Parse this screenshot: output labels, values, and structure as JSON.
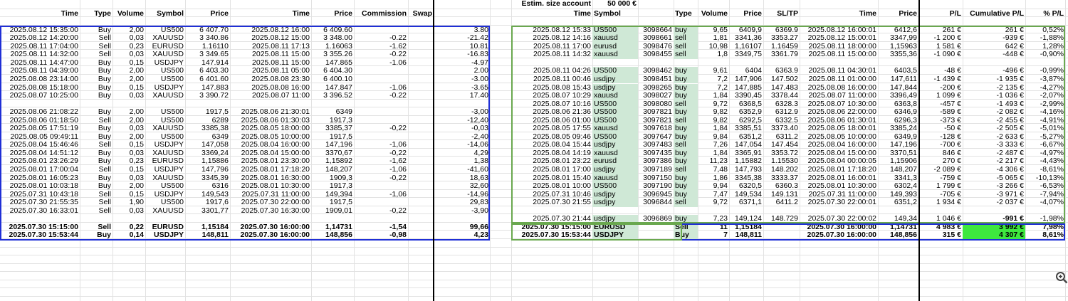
{
  "top": {
    "label": "Estim. size account",
    "value": "50 000 €"
  },
  "left_headers": [
    "Time",
    "Type",
    "Volume",
    "Symbol",
    "Price",
    "Time",
    "Price",
    "Commission",
    "Swap",
    ""
  ],
  "right_headers": [
    "Time",
    "Symbol",
    "",
    "Type",
    "Volume",
    "Price",
    "SL/TP",
    "Time",
    "Price",
    "P/L",
    "Cumulative P/L",
    "% P/L"
  ],
  "left_rows": [
    [
      "2025.08.12 15:35:00",
      "Buy",
      "2,00",
      "US500",
      "6 407.70",
      "2025.08.12 16:00",
      "6 409.60",
      "",
      "",
      "3.80"
    ],
    [
      "2025.08.12 14:20:00",
      "Sell",
      "0,03",
      "XAUUSD",
      "3 340.86",
      "2025.08.12 15:00",
      "3 348.00",
      "-0.22",
      "",
      "-21.42"
    ],
    [
      "2025.08.11 17:04:00",
      "Sell",
      "0,23",
      "EURUSD",
      "1.16110",
      "2025.08.11 17:13",
      "1.16063",
      "-1.62",
      "",
      "10.81"
    ],
    [
      "2025.08.11 14:32:00",
      "Sell",
      "0,03",
      "XAUUSD",
      "3 349.65",
      "2025.08.11 15:00",
      "3 355.26",
      "-0.22",
      "",
      "-16.83"
    ],
    [
      "2025.08.11 14:47:00",
      "Buy",
      "0,15",
      "USDJPY",
      "147.914",
      "2025.08.11 15:00",
      "147.865",
      "-1.06",
      "",
      "-4.97"
    ],
    [
      "2025.08.11 04:39:00",
      "Buy",
      "2,00",
      "US500",
      "6 403.30",
      "2025.08.11 05:00",
      "6 404.30",
      "",
      "",
      "2.00"
    ],
    [
      "2025.08.08 23:14:00",
      "Buy",
      "2,00",
      "US500",
      "6 401.60",
      "2025.08.08 23:30",
      "6 400.10",
      "",
      "",
      "-3.00"
    ],
    [
      "2025.08.08 15:18:00",
      "Buy",
      "0,15",
      "USDJPY",
      "147.883",
      "2025.08.08 16:00",
      "147.847",
      "-1.06",
      "",
      "-3.65"
    ],
    [
      "2025.08.07 10:25:00",
      "Buy",
      "0,03",
      "XAUUSD",
      "3 390.72",
      "2025.08.07 11:00",
      "3 396.52",
      "-0.22",
      "",
      "17.40"
    ],
    [
      "",
      "",
      "",
      "",
      "",
      "",
      "",
      "",
      "",
      ""
    ],
    [
      "2025.08.06 21:08:22",
      "Buy",
      "2,00",
      "US500",
      "1917,5",
      "2025.08.06 21:30:01",
      "6349",
      "",
      "",
      "-3,00"
    ],
    [
      "2025.08.06 01:18:50",
      "Sell",
      "2,00",
      "US500",
      "6289",
      "2025.08.06 01:30:03",
      "1917,3",
      "",
      "",
      "-12,40"
    ],
    [
      "2025.08.05 17:51:19",
      "Buy",
      "0,03",
      "XAUUSD",
      "3385,38",
      "2025.08.05 18:00:00",
      "3385,37",
      "-0,22",
      "",
      "-0,03"
    ],
    [
      "2025.08.05 09:49:11",
      "Buy",
      "2,00",
      "US500",
      "6349",
      "2025.08.05 10:00:00",
      "1917,5",
      "",
      "",
      "-2,40"
    ],
    [
      "2025.08.04 15:46:46",
      "Sell",
      "0,15",
      "USDJPY",
      "147,058",
      "2025.08.04 16:00:00",
      "147,196",
      "-1,06",
      "",
      "-14,06"
    ],
    [
      "2025.08.04 14:51:12",
      "Buy",
      "0,03",
      "XAUUSD",
      "3369,24",
      "2025.08.04 15:00:00",
      "3370,67",
      "-0,22",
      "",
      "4,29"
    ],
    [
      "2025.08.01 23:26:29",
      "Buy",
      "0,23",
      "EURUSD",
      "1,15886",
      "2025.08.01 23:30:00",
      "1,15892",
      "-1,62",
      "",
      "1,38"
    ],
    [
      "2025.08.01 17:00:04",
      "Sell",
      "0,15",
      "USDJPY",
      "147,796",
      "2025.08.01 17:18:20",
      "148,207",
      "-1,06",
      "",
      "-41,60"
    ],
    [
      "2025.08.01 16:05:23",
      "Buy",
      "0,03",
      "XAUUSD",
      "3345,39",
      "2025.08.01 16:30:00",
      "1909,3",
      "-0,22",
      "",
      "18,63"
    ],
    [
      "2025.08.01 10:03:18",
      "Buy",
      "2,00",
      "US500",
      "6316",
      "2025.08.01 10:30:00",
      "1917,3",
      "",
      "",
      "32,60"
    ],
    [
      "2025.07.31 10:43:18",
      "Sell",
      "0,15",
      "USDJPY",
      "149,543",
      "2025.07.31 11:00:00",
      "149,394",
      "-1,06",
      "",
      "-14,96"
    ],
    [
      "2025.07.30 21:55:35",
      "Sell",
      "1,90",
      "US500",
      "1917,6",
      "2025.07.30 22:00:00",
      "1917,5",
      "",
      "",
      "29,83"
    ],
    [
      "2025.07.30 16:33:01",
      "Sell",
      "0,03",
      "XAUUSD",
      "3301,77",
      "2025.07.30 16:30:00",
      "1909,01",
      "-0,22",
      "",
      "-3,90"
    ],
    [
      "",
      "",
      "",
      "",
      "",
      "",
      "",
      "",
      "",
      ""
    ],
    [
      "2025.07.30 15:15:00",
      "Sell",
      "0,22",
      "EURUSD",
      "1,15184",
      "2025.07.30 16:00:00",
      "1,14731",
      "-1,54",
      "",
      "99,66"
    ],
    [
      "2025.07.30 15:53:44",
      "Buy",
      "0,14",
      "USDJPY",
      "148,811",
      "2025.07.30 16:00:00",
      "148,856",
      "-0,98",
      "",
      "4,23"
    ]
  ],
  "right_rows": [
    [
      "2025.08.12 15:33",
      "US500",
      "3098664",
      "buy",
      "9,65",
      "6409,9",
      "6369.9",
      "2025.08.12 16:00:01",
      "6412,6",
      "261 €",
      "261 €",
      "0,52%"
    ],
    [
      "2025.08.12 14:16",
      "xauusd",
      "3098661",
      "sell",
      "1,81",
      "3341,36",
      "3353.27",
      "2025.08.12 15:00:01",
      "3347,99",
      "-1 200 €",
      "-939 €",
      "-1,88%"
    ],
    [
      "2025.08.11 17:00",
      "eurusd",
      "3098476",
      "sell",
      "10,98",
      "1,16107",
      "1.16459",
      "2025.08.11 18:00:00",
      "1,15963",
      "1 581 €",
      "642 €",
      "1,28%"
    ],
    [
      "2025.08.11 14:32",
      "xauusd",
      "3098455",
      "sell",
      "1,8",
      "3349,75",
      "3361.79",
      "2025.08.11 15:00:00",
      "3355,36",
      "-1 090 €",
      "-448 €",
      "-0,90%"
    ],
    [
      "",
      "",
      "",
      "",
      "",
      "",
      "",
      "",
      "",
      "",
      "",
      ""
    ],
    [
      "2025.08.11 04:26",
      "US500",
      "3098462",
      "buy",
      "9,61",
      "6404",
      "6363.9",
      "2025.08.11 04:30:01",
      "6403,5",
      "-48 €",
      "-496 €",
      "-0,99%"
    ],
    [
      "2025.08.11 00:46",
      "usdjpy",
      "3098451",
      "buy",
      "7,2",
      "147,906",
      "147.502",
      "2025.08.11 01:00:00",
      "147,611",
      "-1 439 €",
      "-1 935 €",
      "-3,87%"
    ],
    [
      "2025.08.08 15:43",
      "usdjpy",
      "3098265",
      "buy",
      "7,2",
      "147,885",
      "147.483",
      "2025.08.08 16:00:00",
      "147,844",
      "-200 €",
      "-2 135 €",
      "-4,27%"
    ],
    [
      "2025.08.07 10:29",
      "xauusd",
      "3098027",
      "buy",
      "1,84",
      "3390,45",
      "3378.44",
      "2025.08.07 11:00:00",
      "3396,49",
      "1 099 €",
      "-1 036 €",
      "-2,07%"
    ],
    [
      "2025.08.07 10:16",
      "US500",
      "3098080",
      "sell",
      "9,72",
      "6368,5",
      "6328.3",
      "2025.08.07 10:30:00",
      "6363,8",
      "-457 €",
      "-1 493 €",
      "-2,99%"
    ],
    [
      "2025.08.06 21:36",
      "US500",
      "3097821",
      "buy",
      "9,82",
      "6352,9",
      "6312.9",
      "2025.08.06 22:00:00",
      "6346,9",
      "-589 €",
      "-2 082 €",
      "-4,16%"
    ],
    [
      "2025.08.06 01:00",
      "US500",
      "3097821",
      "sell",
      "9,82",
      "6292,5",
      "6332.5",
      "2025.08.06 01:30:01",
      "6296,3",
      "-373 €",
      "-2 455 €",
      "-4,91%"
    ],
    [
      "2025.08.05 17:55",
      "xauusd",
      "3097618",
      "buy",
      "1,84",
      "3385,51",
      "3373.40",
      "2025.08.05 18:00:01",
      "3385,24",
      "-50 €",
      "-2 505 €",
      "-5,01%"
    ],
    [
      "2025.08.05 09:46",
      "US500",
      "3097647",
      "buy",
      "9,84",
      "6351,2",
      "6311.2",
      "2025.08.05 10:00:00",
      "6349,9",
      "-128 €",
      "-2 633 €",
      "-5,27%"
    ],
    [
      "2025.08.04 15:44",
      "usdjpy",
      "3097483",
      "sell",
      "7,26",
      "147,054",
      "147.454",
      "2025.08.04 16:00:00",
      "147,196",
      "-700 €",
      "-3 333 €",
      "-6,67%"
    ],
    [
      "2025.08.04 14:19",
      "xauusd",
      "3097435",
      "buy",
      "1,84",
      "3365,91",
      "3353.72",
      "2025.08.04 15:00:00",
      "3370,51",
      "846 €",
      "-2 487 €",
      "-4,97%"
    ],
    [
      "2025.08.01 23:22",
      "eurusd",
      "3097386",
      "buy",
      "11,23",
      "1,15882",
      "1.15530",
      "2025.08.04 00:00:05",
      "1,15906",
      "270 €",
      "-2 217 €",
      "-4,43%"
    ],
    [
      "2025.08.01 17:00",
      "usdjpy",
      "3097189",
      "sell",
      "7,48",
      "147,793",
      "148.202",
      "2025.08.01 17:18:20",
      "148,207",
      "-2 089 €",
      "-4 306 €",
      "-8,61%"
    ],
    [
      "2025.08.01 15:40",
      "xauusd",
      "3097150",
      "buy",
      "1,86",
      "3345,38",
      "3333.37",
      "2025.08.01 16:00:01",
      "3341,3",
      "-759 €",
      "-5 065 €",
      "-10,13%"
    ],
    [
      "2025.08.01 10:00",
      "US500",
      "3097190",
      "buy",
      "9,94",
      "6320,5",
      "6360.3",
      "2025.08.01 10:30:00",
      "6302,4",
      "1 799 €",
      "-3 266 €",
      "-6,53%"
    ],
    [
      "2025.07.31 10:46",
      "usdjpy",
      "3096945",
      "buy",
      "7,47",
      "149,534",
      "149.131",
      "2025.07.31 11:00:00",
      "149,393",
      "-705 €",
      "-3 971 €",
      "-7,94%"
    ],
    [
      "2025.07.30 21:55",
      "usdjpy",
      "3096844",
      "sell",
      "9,72",
      "6371,1",
      "6411.2",
      "2025.07.30 22:00:01",
      "6351,2",
      "1 934 €",
      "-2 037 €",
      "-4,07%"
    ],
    [
      "",
      "",
      "",
      "",
      "",
      "",
      "",
      "",
      "",
      "",
      "",
      ""
    ],
    [
      "2025.07.30 21:44",
      "usdjpy",
      "3096869",
      "buy",
      "7,23",
      "149,124",
      "148.729",
      "2025.07.30 22:00:02",
      "149,34",
      "1 046 €",
      "-991 €",
      "-1,98%"
    ],
    [
      "2025.07.30 15:15:00",
      "EURUSD",
      "",
      "Sell",
      "11",
      "1,15184",
      "",
      "2025.07.30 16:00:00",
      "1,14731",
      "4 983 €",
      "3 992 €",
      "7,98%"
    ],
    [
      "2025.07.30 15:53:44",
      "USDJPY",
      "",
      "Buy",
      "7",
      "148,811",
      "",
      "2025.07.30 16:00:00",
      "148,856",
      "315 €",
      "4 307 €",
      "8,61%"
    ]
  ],
  "colors": {
    "blue_border": "#1f2fd6",
    "green_border": "#6aa84f",
    "symbol_fill": "#cfe8d6",
    "highlight": "#3ee83e"
  }
}
